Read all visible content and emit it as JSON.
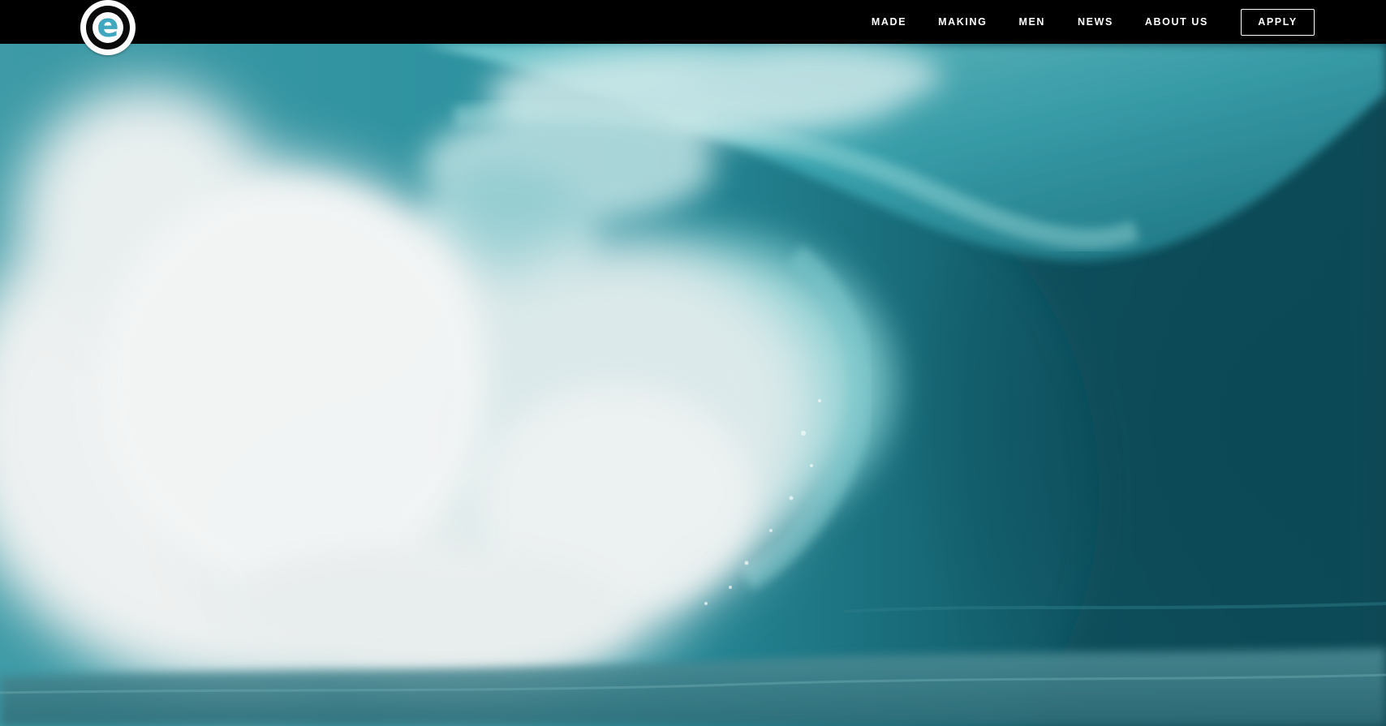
{
  "header": {
    "logo_letter": "e",
    "nav": [
      {
        "label": "MADE"
      },
      {
        "label": "MAKING"
      },
      {
        "label": "MEN"
      },
      {
        "label": "NEWS"
      },
      {
        "label": "ABOUT US"
      }
    ],
    "apply_label": "APPLY"
  },
  "colors": {
    "header_bg": "#000000",
    "logo_accent": "#3fa7bf",
    "wave_deep": "#0f4c58",
    "wave_mid": "#2a8f9d",
    "wave_light": "#6cc3c9",
    "foam": "#eaeeee"
  },
  "hero": {
    "media_name": "hero-wave-image"
  }
}
